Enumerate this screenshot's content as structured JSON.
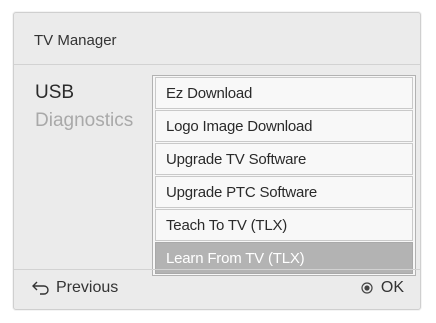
{
  "header": {
    "title": "TV Manager"
  },
  "menu": {
    "items": [
      {
        "label": "USB",
        "state": "active"
      },
      {
        "label": "Diagnostics",
        "state": "dim"
      }
    ]
  },
  "submenu": {
    "items": [
      {
        "label": "Ez Download"
      },
      {
        "label": "Logo Image Download"
      },
      {
        "label": "Upgrade TV Software"
      },
      {
        "label": "Upgrade PTC Software"
      },
      {
        "label": "Teach To TV (TLX)"
      },
      {
        "label": "Learn From TV (TLX)",
        "selected": true
      }
    ]
  },
  "footer": {
    "previous_label": "Previous",
    "previous_icon": "back-arrow-icon",
    "ok_label": "OK",
    "ok_icon": "radio-ok-icon"
  },
  "colors": {
    "panel_bg": "#ebebeb",
    "selected_bg": "#b3b3b3"
  }
}
